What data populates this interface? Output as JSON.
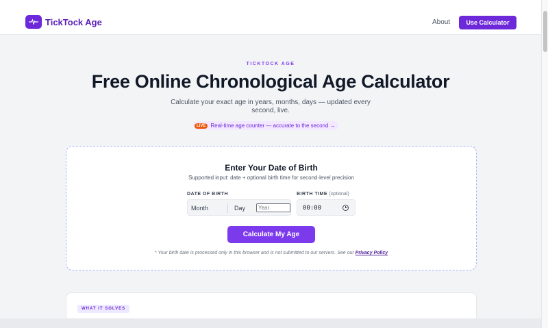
{
  "header": {
    "logo_text": "TickTock Age",
    "nav_about": "About",
    "cta_label": "Use Calculator"
  },
  "hero": {
    "eyebrow": "TICKTOCK AGE",
    "title": "Free Online Chronological Age Calculator",
    "subtitle": "Calculate your exact age in years, months, days — updated every second, live.",
    "live_badge": "LIVE",
    "live_text": "Real-time age counter — accurate to the second →"
  },
  "calculator": {
    "title": "Enter Your Date of Birth",
    "subtitle": "Supported input: date + optional birth time for second-level precision",
    "dob_label": "DATE OF BIRTH",
    "month_placeholder": "Month",
    "day_placeholder": "Day",
    "year_placeholder": "Year",
    "time_label": "BIRTH TIME",
    "time_optional": "(optional)",
    "time_value": "00:00",
    "button_label": "Calculate My Age",
    "disclaimer": "* Your birth date is processed only in this browser and is not submitted to our servers. See our ",
    "privacy_link": "Privacy Policy"
  },
  "section2": {
    "badge": "WHAT IT SOLVES"
  },
  "colors": {
    "brand": "#6d28d9",
    "accent": "#7c3aed",
    "live": "#ea580c"
  },
  "icons": {
    "logo": "pulse-icon",
    "time": "clock-icon"
  }
}
